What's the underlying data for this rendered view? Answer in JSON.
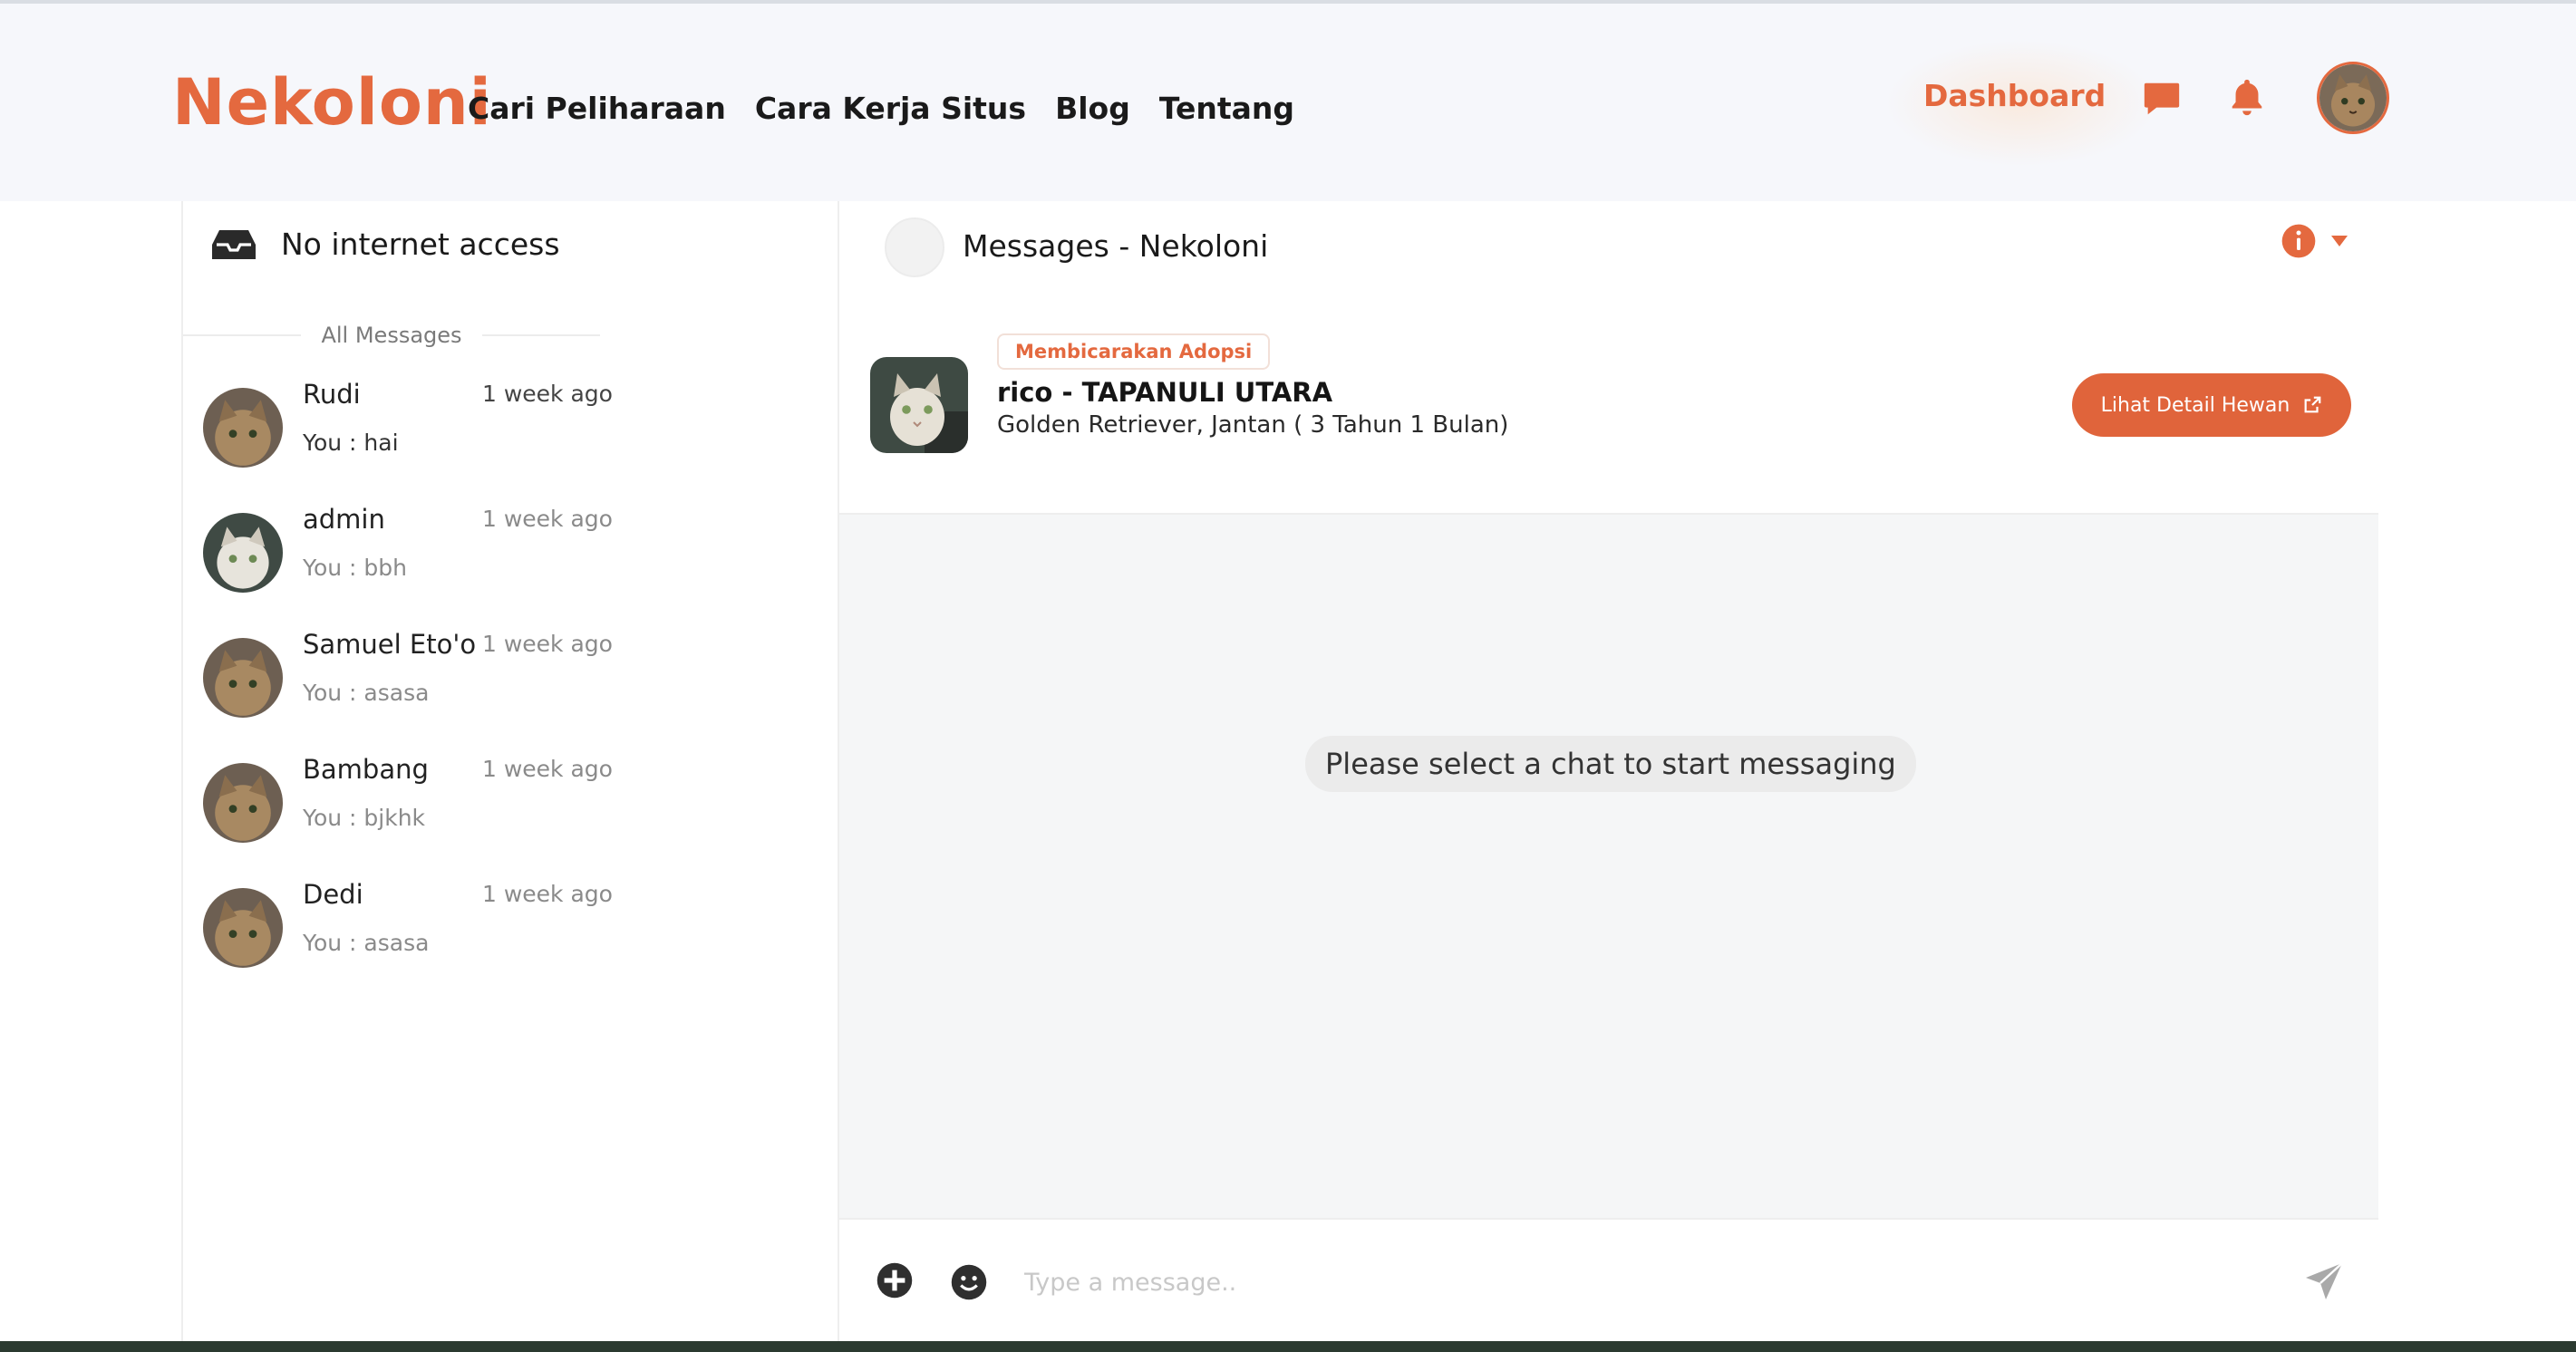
{
  "brand": {
    "logo": "Nekoloni",
    "accent": "#e4693f"
  },
  "nav": {
    "items": [
      {
        "label": "Cari Peliharaan"
      },
      {
        "label": "Cara Kerja Situs"
      },
      {
        "label": "Blog"
      },
      {
        "label": "Tentang"
      }
    ],
    "dashboard": "Dashboard",
    "icons": [
      "chat-icon",
      "bell-icon",
      "avatar"
    ]
  },
  "sidebar": {
    "title": "No internet access",
    "title_icon": "inbox-icon",
    "section_label": "All Messages",
    "conversations": [
      {
        "name": "Rudi",
        "time": "1 week ago",
        "preview": "You : hai"
      },
      {
        "name": "admin",
        "time": "1 week ago",
        "preview": "You : bbh"
      },
      {
        "name": "Samuel Eto'o",
        "time": "1 week ago",
        "preview": "You : asasa"
      },
      {
        "name": "Bambang",
        "time": "1 week ago",
        "preview": "You : bjkhk"
      },
      {
        "name": "Dedi",
        "time": "1 week ago",
        "preview": "You : asasa"
      }
    ]
  },
  "chat": {
    "title": "Messages - Nekoloni",
    "badge": "Membicarakan Adopsi",
    "pet_name": "rico - TAPANULI UTARA",
    "pet_desc": "Golden Retriever, Jantan ( 3 Tahun 1 Bulan)",
    "detail_button": "Lihat Detail Hewan",
    "empty_state": "Please select a chat to start messaging",
    "input_placeholder": "Type a message.."
  }
}
